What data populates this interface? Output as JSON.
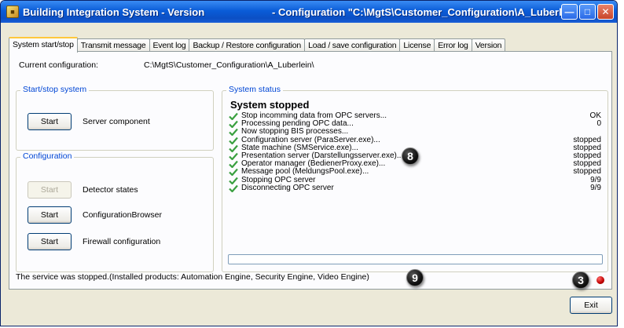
{
  "window": {
    "title_left": "Building Integration System - Version",
    "title_right": "- Configuration \"C:\\MgtS\\Customer_Configuration\\A_Luberl...",
    "icon": "building-icon"
  },
  "titlebar_buttons": {
    "minimize_icon": "minimize-icon",
    "maximize_icon": "maximize-icon",
    "close_icon": "close-icon"
  },
  "tabs": [
    {
      "label": "System start/stop",
      "active": true
    },
    {
      "label": "Transmit message"
    },
    {
      "label": "Event log"
    },
    {
      "label": "Backup / Restore configuration"
    },
    {
      "label": "Load / save configuration"
    },
    {
      "label": "License"
    },
    {
      "label": "Error log"
    },
    {
      "label": "Version"
    }
  ],
  "current_configuration": {
    "label": "Current configuration:",
    "value": "C:\\MgtS\\Customer_Configuration\\A_Luberlein\\"
  },
  "start_stop_group": {
    "title": "Start/stop system",
    "button": "Start",
    "label": "Server component"
  },
  "configuration_group": {
    "title": "Configuration",
    "rows": [
      {
        "button": "Start",
        "label": "Detector states",
        "enabled": false
      },
      {
        "button": "Start",
        "label": "ConfigurationBrowser",
        "enabled": true
      },
      {
        "button": "Start",
        "label": "Firewall configuration",
        "enabled": true
      }
    ]
  },
  "system_status": {
    "group_title": "System status",
    "heading": "System stopped",
    "items": [
      {
        "text": "Stop incomming data from OPC servers...",
        "value": "OK"
      },
      {
        "text": "Processing pending OPC data...",
        "value": "0"
      },
      {
        "text": "Now stopping BIS processes...",
        "value": ""
      },
      {
        "text": "Configuration server (ParaServer.exe)...",
        "value": "stopped"
      },
      {
        "text": "State machine (SMService.exe)...",
        "value": "stopped"
      },
      {
        "text": "Presentation server (Darstellungsserver.exe)...",
        "value": "stopped"
      },
      {
        "text": "Operator manager (BedienerProxy.exe)...",
        "value": "stopped"
      },
      {
        "text": "Message pool (MeldungsPool.exe)...",
        "value": "stopped"
      },
      {
        "text": "Stopping OPC server",
        "value": "9/9"
      },
      {
        "text": "Disconnecting OPC server",
        "value": "9/9"
      }
    ],
    "progress": 0
  },
  "status_bar": {
    "text": "The service was stopped.(Installed products: Automation Engine, Security Engine, Video Engine)",
    "led_color": "#c00000"
  },
  "callouts": {
    "status": "8",
    "message": "9",
    "led": "3"
  },
  "exit_button": "Exit",
  "colors": {
    "title_bar": "#0b4fc4",
    "group_title": "#0046d5",
    "check": "#3aa040",
    "tab_highlight": "#ffc83c"
  }
}
